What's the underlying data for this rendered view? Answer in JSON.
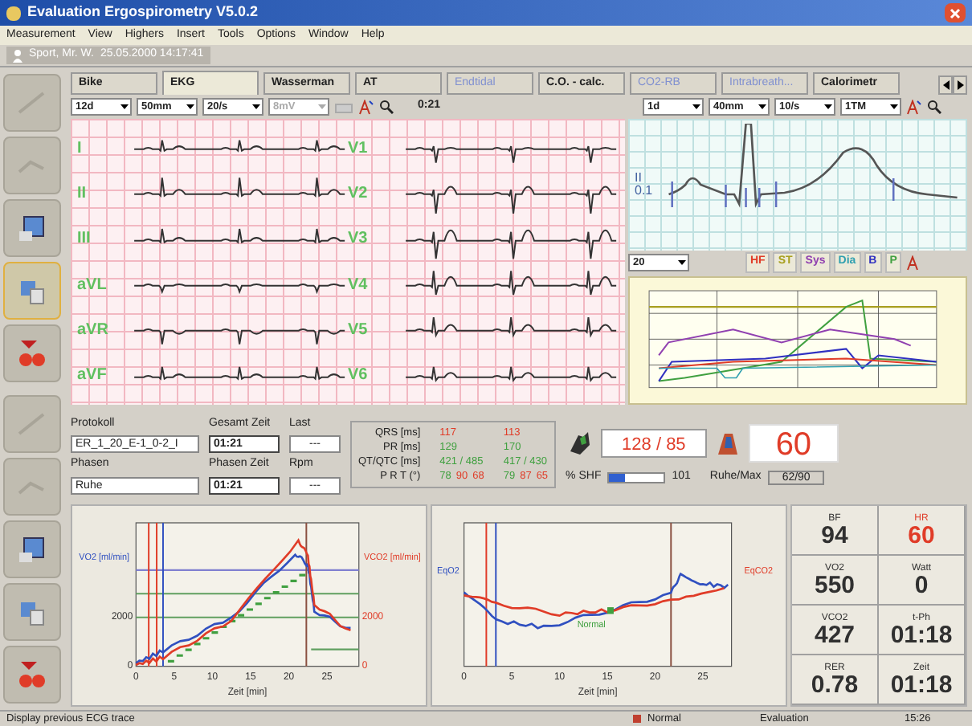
{
  "window": {
    "title": "Evaluation Ergospirometry V5.0.2"
  },
  "menu": [
    "Measurement",
    "View",
    "Highers",
    "Insert",
    "Tools",
    "Options",
    "Window",
    "Help"
  ],
  "patient": {
    "name": "Sport, Mr. W.",
    "date": "25.05.2000 14:17:41"
  },
  "sidebar_top": [
    {
      "selected": false
    },
    {
      "selected": false
    },
    {
      "selected": false
    },
    {
      "selected": true
    },
    {
      "selected": false
    }
  ],
  "sidebar_bottom": [
    {
      "selected": false
    },
    {
      "selected": false
    },
    {
      "selected": false
    },
    {
      "selected": false
    },
    {
      "selected": false
    }
  ],
  "tabs": [
    {
      "label": "Bike",
      "selected": false,
      "disabled": false
    },
    {
      "label": "EKG",
      "selected": true,
      "disabled": false
    },
    {
      "label": "Wasserman",
      "selected": false,
      "disabled": false
    },
    {
      "label": "AT",
      "selected": false,
      "disabled": false
    },
    {
      "label": "Endtidal",
      "selected": false,
      "disabled": true
    },
    {
      "label": "C.O. - calc.",
      "selected": false,
      "disabled": false
    },
    {
      "label": "CO2-RB",
      "selected": false,
      "disabled": true
    },
    {
      "label": "Intrabreath...",
      "selected": false,
      "disabled": true
    },
    {
      "label": "Calorimetr",
      "selected": false,
      "disabled": false
    }
  ],
  "ecg_toolbar": {
    "selects": [
      {
        "value": "12d",
        "disabled": false
      },
      {
        "value": "50mm",
        "disabled": false
      },
      {
        "value": "20/s",
        "disabled": false
      },
      {
        "value": "8mV",
        "disabled": true
      }
    ],
    "time": "0:21"
  },
  "ecg_leads": [
    {
      "label": "I"
    },
    {
      "label": "II"
    },
    {
      "label": "III"
    },
    {
      "label": "aVL"
    },
    {
      "label": "aVR"
    },
    {
      "label": "aVF"
    },
    {
      "label": "V1"
    },
    {
      "label": "V2"
    },
    {
      "label": "V3"
    },
    {
      "label": "V4"
    },
    {
      "label": "V5"
    },
    {
      "label": "V6"
    }
  ],
  "beat_panel": {
    "selects": [
      {
        "value": "1d"
      },
      {
        "value": "40mm"
      },
      {
        "value": "10/s"
      },
      {
        "value": "1TM"
      }
    ],
    "lead": "II",
    "scale": "0.1"
  },
  "trend": {
    "select": "20",
    "buttons": [
      {
        "label": "HF",
        "color": "#e03c28"
      },
      {
        "label": "ST",
        "color": "#a8a020"
      },
      {
        "label": "Sys",
        "color": "#9040b0"
      },
      {
        "label": "Dia",
        "color": "#30a0b0"
      },
      {
        "label": "B",
        "color": "#3030c0"
      },
      {
        "label": "P",
        "color": "#40a040"
      }
    ]
  },
  "protocol": {
    "label": "Protokoll",
    "value": "ER_1_20_E-1_0-2_I",
    "phase_label": "Phasen",
    "phase": "Ruhe"
  },
  "times": {
    "total_label": "Gesamt Zeit",
    "total": "01:21",
    "phase_label": "Phasen Zeit",
    "phase": "01:21"
  },
  "load": {
    "label": "Last",
    "value": "---",
    "rpm_label": "Rpm",
    "rpm": "---"
  },
  "intervals": [
    {
      "label": "QRS [ms]",
      "a": [
        {
          "text": "117",
          "color": "#e03c28"
        }
      ],
      "b": [
        {
          "text": "113",
          "color": "#e03c28"
        }
      ]
    },
    {
      "label": "PR [ms]",
      "a": [
        {
          "text": "129",
          "color": "#40a040"
        }
      ],
      "b": [
        {
          "text": "170",
          "color": "#40a040"
        }
      ]
    },
    {
      "label": "QT/QTC [ms]",
      "a": [
        {
          "text": "421 / 485",
          "color": "#40a040"
        }
      ],
      "b": [
        {
          "text": "417 / 430",
          "color": "#40a040"
        }
      ]
    },
    {
      "label": "P R T (°)",
      "a": [
        {
          "text": "78",
          "color": "#40a040"
        },
        {
          "text": "90",
          "color": "#e03c28"
        },
        {
          "text": "68",
          "color": "#e03c28"
        }
      ],
      "b": [
        {
          "text": "79",
          "color": "#40a040"
        },
        {
          "text": "87",
          "color": "#e03c28"
        },
        {
          "text": "65",
          "color": "#e03c28"
        }
      ]
    }
  ],
  "blood_pressure": "128 / 85",
  "heart_rate": "60",
  "shf": {
    "label": "% SHF",
    "level": 0.3,
    "value": "101"
  },
  "rest_max": {
    "label": "Ruhe/Max",
    "value": "62/90"
  },
  "vo2_chart": {
    "left_label": "VO2 [ml/min]",
    "right_label": "VCO2 [ml/min]",
    "xlabel": "Zeit [min]",
    "xticks": [
      "0",
      "5",
      "10",
      "15",
      "20",
      "25"
    ],
    "left_ticks": [
      "2000",
      "0"
    ],
    "right_ticks": [
      "2000",
      "0"
    ]
  },
  "eq_chart": {
    "left_label": "EqO2",
    "right_label": "EqCO2",
    "xlabel": "Zeit [min]",
    "xticks": [
      "0",
      "5",
      "10",
      "15",
      "20",
      "25"
    ],
    "marker": "Normal"
  },
  "values": [
    {
      "label": "BF",
      "value": "94",
      "color": "#303030"
    },
    {
      "label": "HR",
      "value": "60",
      "color": "#e03c28"
    },
    {
      "label": "VO2",
      "value": "550",
      "color": "#303030"
    },
    {
      "label": "Watt",
      "value": "0",
      "color": "#303030"
    },
    {
      "label": "VCO2",
      "value": "427",
      "color": "#303030"
    },
    {
      "label": "t-Ph",
      "value": "01:18",
      "color": "#303030"
    },
    {
      "label": "RER",
      "value": "0.78",
      "color": "#303030"
    },
    {
      "label": "Zeit",
      "value": "01:18",
      "color": "#303030"
    }
  ],
  "status_bar": {
    "message": "Display previous ECG trace",
    "mode": "Normal",
    "state": "Evaluation",
    "time": "15:26"
  }
}
